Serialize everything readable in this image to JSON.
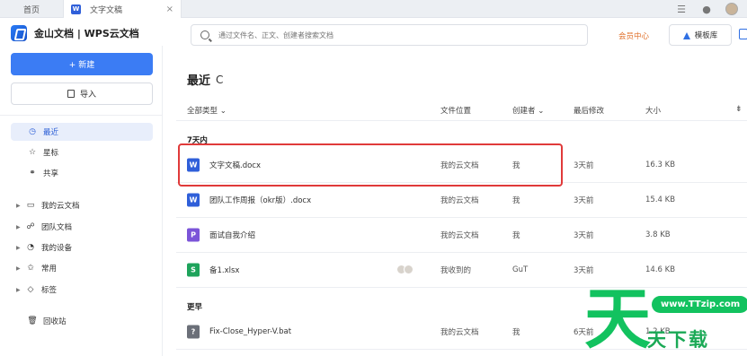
{
  "tabs": {
    "home": "首页",
    "doc": "文字文稿",
    "close": "×"
  },
  "app": {
    "brand": "金山文档 | WPS云文档"
  },
  "search": {
    "placeholder": "通过文件名、正文、创建者搜索文档"
  },
  "header": {
    "member": "会员中心",
    "template": "模板库"
  },
  "sidebar": {
    "new_label": "+ 新建",
    "import_label": "导入",
    "top_items": [
      {
        "label": "最近",
        "icon": "clock-icon"
      },
      {
        "label": "星标",
        "icon": "star-icon"
      },
      {
        "label": "共享",
        "icon": "share-icon"
      }
    ],
    "tree_items": [
      {
        "label": "我的云文档",
        "icon": "folder-icon"
      },
      {
        "label": "团队文档",
        "icon": "team-icon"
      },
      {
        "label": "我的设备",
        "icon": "device-icon"
      },
      {
        "label": "常用",
        "icon": "pin-icon"
      },
      {
        "label": "标签",
        "icon": "tag-icon"
      }
    ],
    "trash_label": "回收站"
  },
  "main": {
    "title": "最近",
    "columns": {
      "type": "全部类型",
      "location": "文件位置",
      "creator": "创建者",
      "modified": "最后修改",
      "size": "大小"
    },
    "group_recent": "7天内",
    "group_earlier": "更早",
    "files": [
      {
        "name": "文字文稿.docx",
        "type": "W",
        "color": "#2f5fd9",
        "location": "我的云文档",
        "creator": "我",
        "modified": "3天前",
        "size": "16.3 KB"
      },
      {
        "name": "团队工作周报（okr版）.docx",
        "type": "W",
        "color": "#2f5fd9",
        "location": "我的云文档",
        "creator": "我",
        "modified": "3天前",
        "size": "15.4 KB"
      },
      {
        "name": "面试自我介绍",
        "type": "P",
        "color": "#7b54d8",
        "location": "我的云文档",
        "creator": "我",
        "modified": "3天前",
        "size": "3.8 KB"
      },
      {
        "name": "备1.xlsx",
        "type": "S",
        "color": "#1ea35b",
        "location": "我收到的",
        "creator": "GuT",
        "modified": "3天前",
        "size": "14.6 KB"
      },
      {
        "name": "Fix-Close_Hyper-V.bat",
        "type": "?",
        "color": "#6b6f78",
        "location": "我的云文档",
        "creator": "我",
        "modified": "6天前",
        "size": "1.2 KB"
      }
    ]
  },
  "watermark": {
    "big": "天",
    "url": "www.TTzip.com",
    "text": "天下载"
  }
}
